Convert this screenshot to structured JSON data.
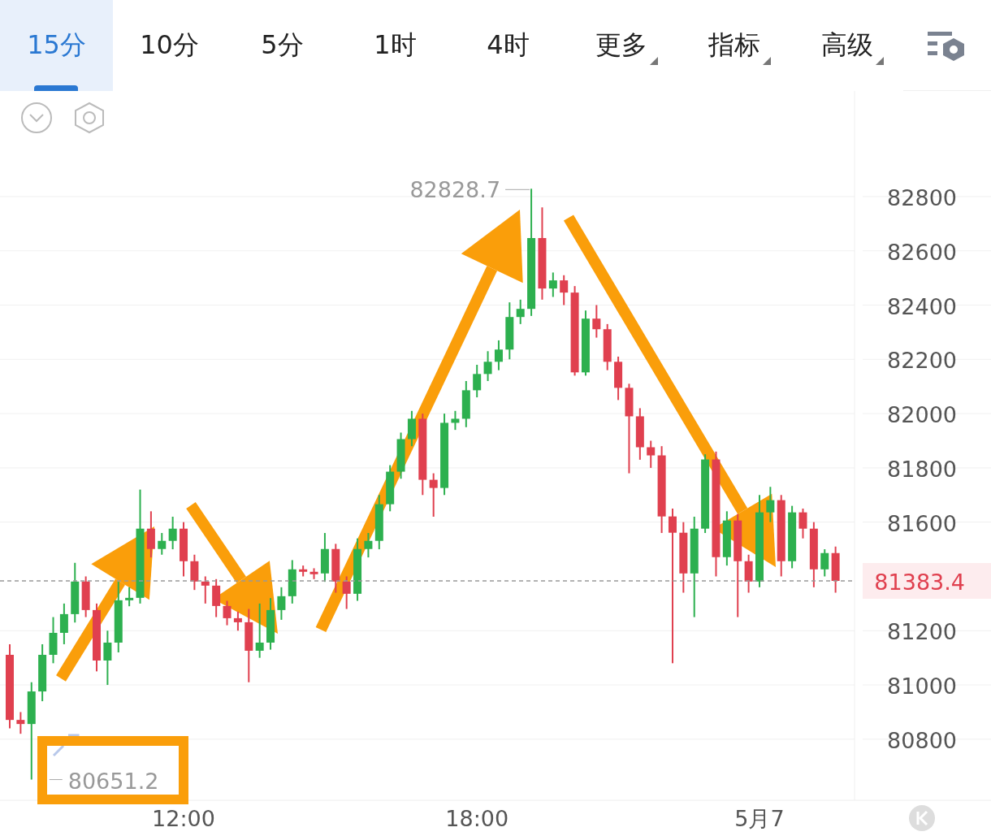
{
  "tabs": [
    {
      "label": "15分",
      "selected": true,
      "dropdown": false
    },
    {
      "label": "10分",
      "selected": false,
      "dropdown": false
    },
    {
      "label": "5分",
      "selected": false,
      "dropdown": false
    },
    {
      "label": "1时",
      "selected": false,
      "dropdown": false
    },
    {
      "label": "4时",
      "selected": false,
      "dropdown": false
    },
    {
      "label": "更多",
      "selected": false,
      "dropdown": true
    },
    {
      "label": "指标",
      "selected": false,
      "dropdown": true
    },
    {
      "label": "高级",
      "selected": false,
      "dropdown": true
    }
  ],
  "chart": {
    "high_label": "82828.7",
    "low_label": "80651.2",
    "x_axis_labels": [
      "12:00",
      "18:00",
      "5月7"
    ],
    "chart_data": {
      "type": "candlestick",
      "yticks": [
        82800,
        82600,
        82400,
        82200,
        82000,
        81800,
        81600,
        81200,
        81000,
        80800
      ],
      "ylim": [
        80575,
        83186
      ],
      "grid": true,
      "ref_lines": [
        {
          "axis": "y",
          "value": 81383.4,
          "label": "81383.4"
        }
      ],
      "ohlc": [
        [
          81111,
          81150,
          80840,
          80871
        ],
        [
          80871,
          80900,
          80820,
          80856
        ],
        [
          80856,
          81010,
          80651.2,
          80976
        ],
        [
          80976,
          81150,
          80940,
          81111
        ],
        [
          81111,
          81250,
          81080,
          81192
        ],
        [
          81192,
          81300,
          81150,
          81261
        ],
        [
          81261,
          81450,
          81230,
          81381
        ],
        [
          81381,
          81400,
          81250,
          81276
        ],
        [
          81276,
          81300,
          81050,
          81090
        ],
        [
          81090,
          81200,
          81000,
          81156
        ],
        [
          81156,
          81380,
          81120,
          81312
        ],
        [
          81312,
          81360,
          81290,
          81321
        ],
        [
          81321,
          81720,
          81300,
          81576
        ],
        [
          81576,
          81640,
          81470,
          81501
        ],
        [
          81501,
          81560,
          81480,
          81531
        ],
        [
          81531,
          81620,
          81500,
          81576
        ],
        [
          81576,
          81600,
          81400,
          81456
        ],
        [
          81456,
          81480,
          81350,
          81381
        ],
        [
          81381,
          81400,
          81300,
          81366
        ],
        [
          81366,
          81390,
          81250,
          81291
        ],
        [
          81291,
          81310,
          81220,
          81246
        ],
        [
          81246,
          81270,
          81200,
          81231
        ],
        [
          81231,
          81280,
          81010,
          81126
        ],
        [
          81126,
          81300,
          81100,
          81156
        ],
        [
          81156,
          81320,
          81130,
          81276
        ],
        [
          81276,
          81360,
          81240,
          81327
        ],
        [
          81327,
          81460,
          81300,
          81426
        ],
        [
          81426,
          81440,
          81400,
          81417
        ],
        [
          81417,
          81430,
          81390,
          81411
        ],
        [
          81411,
          81560,
          81380,
          81501
        ],
        [
          81501,
          81520,
          81340,
          81381
        ],
        [
          81381,
          81400,
          81280,
          81336
        ],
        [
          81336,
          81540,
          81310,
          81501
        ],
        [
          81501,
          81560,
          81470,
          81531
        ],
        [
          81531,
          81700,
          81500,
          81666
        ],
        [
          81666,
          81810,
          81640,
          81786
        ],
        [
          81786,
          81930,
          81760,
          81906
        ],
        [
          81906,
          82010,
          81880,
          81981
        ],
        [
          81981,
          82000,
          81700,
          81756
        ],
        [
          81756,
          81780,
          81620,
          81726
        ],
        [
          81726,
          82000,
          81700,
          81966
        ],
        [
          81966,
          82010,
          81940,
          81981
        ],
        [
          81981,
          82120,
          81950,
          82086
        ],
        [
          82086,
          82180,
          82060,
          82146
        ],
        [
          82146,
          82230,
          82120,
          82191
        ],
        [
          82191,
          82270,
          82160,
          82236
        ],
        [
          82236,
          82410,
          82200,
          82356
        ],
        [
          82356,
          82420,
          82330,
          82386
        ],
        [
          82386,
          82828.7,
          82360,
          82647
        ],
        [
          82647,
          82760,
          82420,
          82461
        ],
        [
          82461,
          82520,
          82430,
          82491
        ],
        [
          82491,
          82510,
          82400,
          82446
        ],
        [
          82446,
          82470,
          82140,
          82152
        ],
        [
          82152,
          82380,
          82140,
          82350
        ],
        [
          82350,
          82400,
          82280,
          82311
        ],
        [
          82311,
          82330,
          82160,
          82191
        ],
        [
          82191,
          82210,
          82050,
          82095
        ],
        [
          82095,
          82110,
          81780,
          81990
        ],
        [
          81990,
          82020,
          81830,
          81876
        ],
        [
          81876,
          81900,
          81800,
          81846
        ],
        [
          81846,
          81880,
          81560,
          81621
        ],
        [
          81621,
          81650,
          81080,
          81561
        ],
        [
          81561,
          81600,
          81340,
          81411
        ],
        [
          81411,
          81620,
          81250,
          81576
        ],
        [
          81576,
          81850,
          81560,
          81831
        ],
        [
          81831,
          81860,
          81400,
          81471
        ],
        [
          81471,
          81640,
          81440,
          81606
        ],
        [
          81606,
          81630,
          81250,
          81456
        ],
        [
          81456,
          81480,
          81340,
          81381
        ],
        [
          81381,
          81700,
          81360,
          81636
        ],
        [
          81636,
          81730,
          81600,
          81681
        ],
        [
          81681,
          81700,
          81400,
          81456
        ],
        [
          81456,
          81660,
          81430,
          81636
        ],
        [
          81636,
          81650,
          81540,
          81576
        ],
        [
          81576,
          81600,
          81360,
          81426
        ],
        [
          81426,
          81500,
          81400,
          81486
        ],
        [
          81486,
          81510,
          81340,
          81383.4
        ]
      ]
    }
  }
}
